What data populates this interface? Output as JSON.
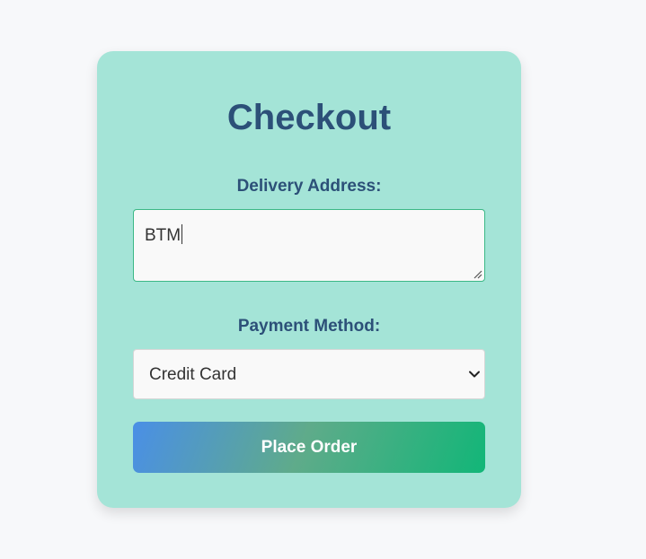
{
  "checkout": {
    "title": "Checkout",
    "delivery_address_label": "Delivery Address:",
    "delivery_address_value": "BTM",
    "payment_method_label": "Payment Method:",
    "payment_method_selected": "Credit Card",
    "place_order_label": "Place Order"
  },
  "colors": {
    "page_background": "#f7f8fa",
    "card_background": "#a4e4d7",
    "heading_text": "#2c5078",
    "textarea_border_focus": "#3bb886",
    "button_gradient_start": "#4a8fe6",
    "button_gradient_mid": "#5fab8a",
    "button_gradient_end": "#12b678"
  },
  "icons": {
    "select_chevron": "chevron-down-icon",
    "textarea_resize": "resize-grip-icon"
  }
}
